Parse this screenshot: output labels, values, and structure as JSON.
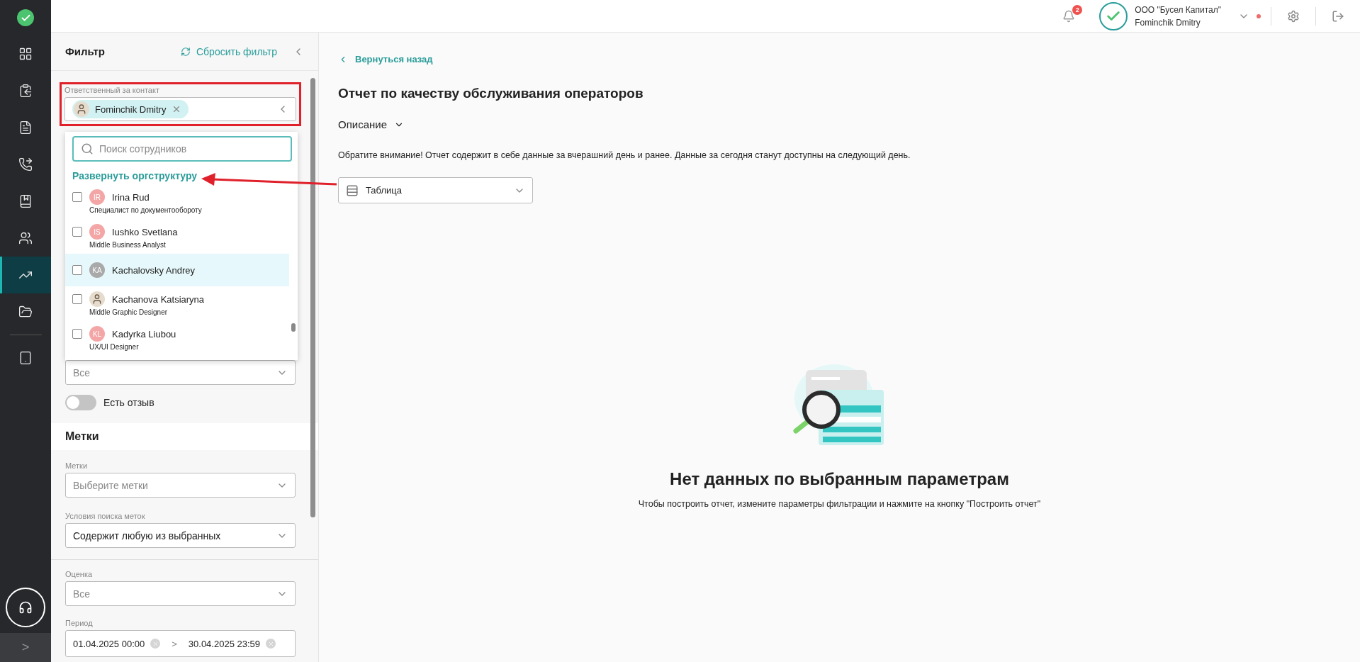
{
  "sidebar": {
    "items": [
      {
        "kind": "grid",
        "selected": false
      },
      {
        "kind": "clipboard",
        "selected": false
      },
      {
        "kind": "document",
        "selected": false
      },
      {
        "kind": "phone",
        "selected": false
      },
      {
        "kind": "book",
        "selected": false
      },
      {
        "kind": "people",
        "selected": false
      },
      {
        "kind": "chart",
        "selected": true
      },
      {
        "kind": "folder",
        "selected": false
      },
      {
        "kind": "tablet",
        "selected": false
      }
    ],
    "expand": ">"
  },
  "header": {
    "notifications": "2",
    "company": "ООО \"Бусел Капитал\"",
    "user": "Fominchik Dmitry",
    "online": true
  },
  "filter": {
    "title": "Фильтр",
    "reset": "Сбросить фильтр",
    "responsible": {
      "label": "Ответственный за контакт",
      "chip": "Fominchik Dmitry",
      "highlighted": true
    },
    "dropdown": {
      "search_placeholder": "Поиск сотрудников",
      "expand_link": "Развернуть оргструктуру",
      "items": [
        {
          "name": "Irina Rud",
          "role": "Специалист по документообороту",
          "kind": "initials",
          "initials": "IR",
          "checked": false,
          "highlighted": false
        },
        {
          "name": "Iushko Svetlana",
          "role": "Middle Business Analyst",
          "kind": "initials",
          "initials": "IS",
          "checked": false,
          "highlighted": false
        },
        {
          "name": "Kachalovsky Andrey",
          "kind": "initials",
          "initials": "KA",
          "checked": false,
          "highlighted": true
        },
        {
          "name": "Kachanova Katsiaryna",
          "role": "Middle Graphic Designer",
          "kind": "photo",
          "checked": false,
          "highlighted": false
        },
        {
          "name": "Kadyrka Liubou",
          "role": "UX/UI Designer",
          "kind": "initials",
          "initials": "KL",
          "checked": false,
          "highlighted": false
        }
      ]
    },
    "counterparty": {
      "placeholder": "Все"
    },
    "feedback": {
      "label": "Есть отзыв",
      "on": false
    },
    "tags_section": "Метки",
    "tags": {
      "label": "Метки",
      "placeholder": "Выберите метки"
    },
    "tags_condition": {
      "label": "Условия поиска меток",
      "value": "Содержит любую из выбранных"
    },
    "rating": {
      "label": "Оценка",
      "placeholder": "Все"
    },
    "period": {
      "label": "Период",
      "from": "01.04.2025 00:00",
      "separator": ">",
      "to": "30.04.2025 23:59"
    }
  },
  "main": {
    "back": "Вернуться назад",
    "title": "Отчет по качеству обслуживания операторов",
    "description": "Описание",
    "notice": "Обратите внимание! Отчет содержит в себе данные за вчерашний день и ранее. Данные за сегодня станут доступны на следующий день.",
    "view": "Таблица",
    "empty_title": "Нет данных по выбранным параметрам",
    "empty_text": "Чтобы построить отчет, измените параметры фильтрации и нажмите на кнопку \"Построить отчет\""
  },
  "annotation": {
    "arrow": true
  }
}
